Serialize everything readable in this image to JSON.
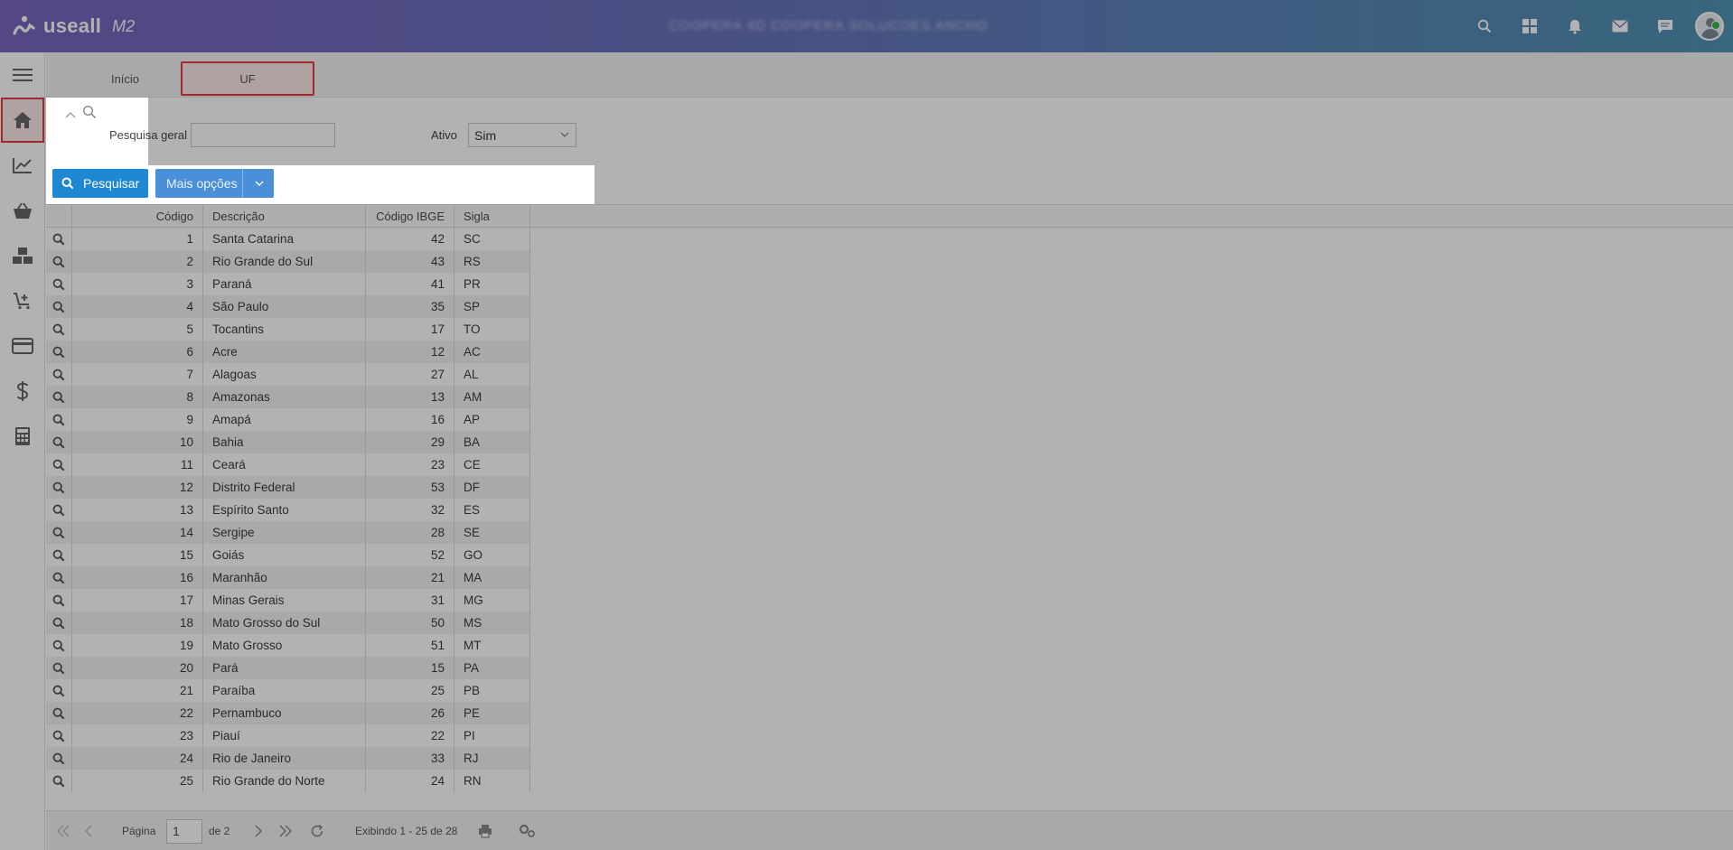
{
  "brand": {
    "name": "useall",
    "version": "M2"
  },
  "header": {
    "blurred_text": "COOPERA 4D  COOPERA SOLUCOES  ANCHO"
  },
  "tabs": {
    "home": "Início",
    "uf": "UF"
  },
  "filter": {
    "general_search_label": "Pesquisa geral",
    "general_search_value": "",
    "active_label": "Ativo",
    "active_value": "Sim"
  },
  "actions": {
    "search": "Pesquisar",
    "more_options": "Mais opções"
  },
  "grid": {
    "headers": [
      "Código",
      "Descrição",
      "Código IBGE",
      "Sigla"
    ],
    "rows": [
      [
        "1",
        "Santa Catarina",
        "42",
        "SC"
      ],
      [
        "2",
        "Rio Grande do Sul",
        "43",
        "RS"
      ],
      [
        "3",
        "Paraná",
        "41",
        "PR"
      ],
      [
        "4",
        "São Paulo",
        "35",
        "SP"
      ],
      [
        "5",
        "Tocantins",
        "17",
        "TO"
      ],
      [
        "6",
        "Acre",
        "12",
        "AC"
      ],
      [
        "7",
        "Alagoas",
        "27",
        "AL"
      ],
      [
        "8",
        "Amazonas",
        "13",
        "AM"
      ],
      [
        "9",
        "Amapá",
        "16",
        "AP"
      ],
      [
        "10",
        "Bahia",
        "29",
        "BA"
      ],
      [
        "11",
        "Ceará",
        "23",
        "CE"
      ],
      [
        "12",
        "Distrito Federal",
        "53",
        "DF"
      ],
      [
        "13",
        "Espírito Santo",
        "32",
        "ES"
      ],
      [
        "14",
        "Sergipe",
        "28",
        "SE"
      ],
      [
        "15",
        "Goiás",
        "52",
        "GO"
      ],
      [
        "16",
        "Maranhão",
        "21",
        "MA"
      ],
      [
        "17",
        "Minas Gerais",
        "31",
        "MG"
      ],
      [
        "18",
        "Mato Grosso do Sul",
        "50",
        "MS"
      ],
      [
        "19",
        "Mato Grosso",
        "51",
        "MT"
      ],
      [
        "20",
        "Pará",
        "15",
        "PA"
      ],
      [
        "21",
        "Paraíba",
        "25",
        "PB"
      ],
      [
        "22",
        "Pernambuco",
        "26",
        "PE"
      ],
      [
        "23",
        "Piauí",
        "22",
        "PI"
      ],
      [
        "24",
        "Rio de Janeiro",
        "33",
        "RJ"
      ],
      [
        "25",
        "Rio Grande do Norte",
        "24",
        "RN"
      ]
    ]
  },
  "pager": {
    "page_label": "Página",
    "page_value": "1",
    "of_label": "de 2",
    "display_text": "Exibindo 1 - 25 de 28"
  },
  "colors": {
    "accent": "#1e88d2",
    "highlight_border": "#e53b3f",
    "highlight_bg": "#fde7e8"
  }
}
